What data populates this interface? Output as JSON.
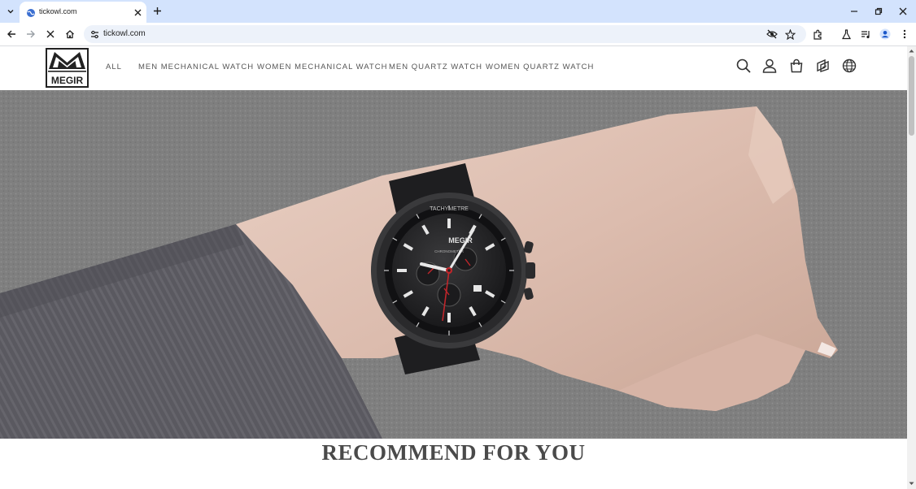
{
  "browser": {
    "tab": {
      "title": "tickowl.com",
      "favicon": "globe-favicon-icon"
    },
    "address_bar": {
      "url": "tickowl.com"
    },
    "icons": {
      "tab_list": "chevron-down-icon",
      "close_tab": "close-icon",
      "new_tab": "plus-icon",
      "back": "back-arrow-icon",
      "forward": "forward-arrow-icon",
      "stop": "stop-loading-icon",
      "home": "home-icon",
      "site_info": "tune-icon",
      "hide": "eye-off-icon",
      "bookmark": "star-icon",
      "extensions": "puzzle-icon",
      "labs": "flask-icon",
      "media": "media-control-icon",
      "profile": "profile-avatar-icon",
      "menu": "kebab-menu-icon"
    }
  },
  "site": {
    "logo_text": "MEGIR",
    "nav": [
      {
        "label": "ALL"
      },
      {
        "label": "MEN  MECHANICAL WATCH"
      },
      {
        "label": "WOMEN  MECHANICAL WATCH"
      },
      {
        "label": "MEN QUARTZ WATCH"
      },
      {
        "label": "WOMEN QUARTZ WATCH"
      }
    ],
    "header_icons": [
      "search-icon",
      "account-icon",
      "cart-icon",
      "orders-icon",
      "language-icon"
    ]
  },
  "hero": {
    "watch_brand": "MEGIR",
    "bezel_label": "TACHYMETRE",
    "dial_label": "CHRONOMETER"
  },
  "recommend": {
    "title": "RECOMMEND FOR YOU"
  },
  "colors": {
    "tabstrip": "#d3e3fd",
    "omnibox": "#edf2fa",
    "nav_text": "#555555",
    "title_text": "#4a4a4a",
    "accent_red": "#c0262b"
  }
}
